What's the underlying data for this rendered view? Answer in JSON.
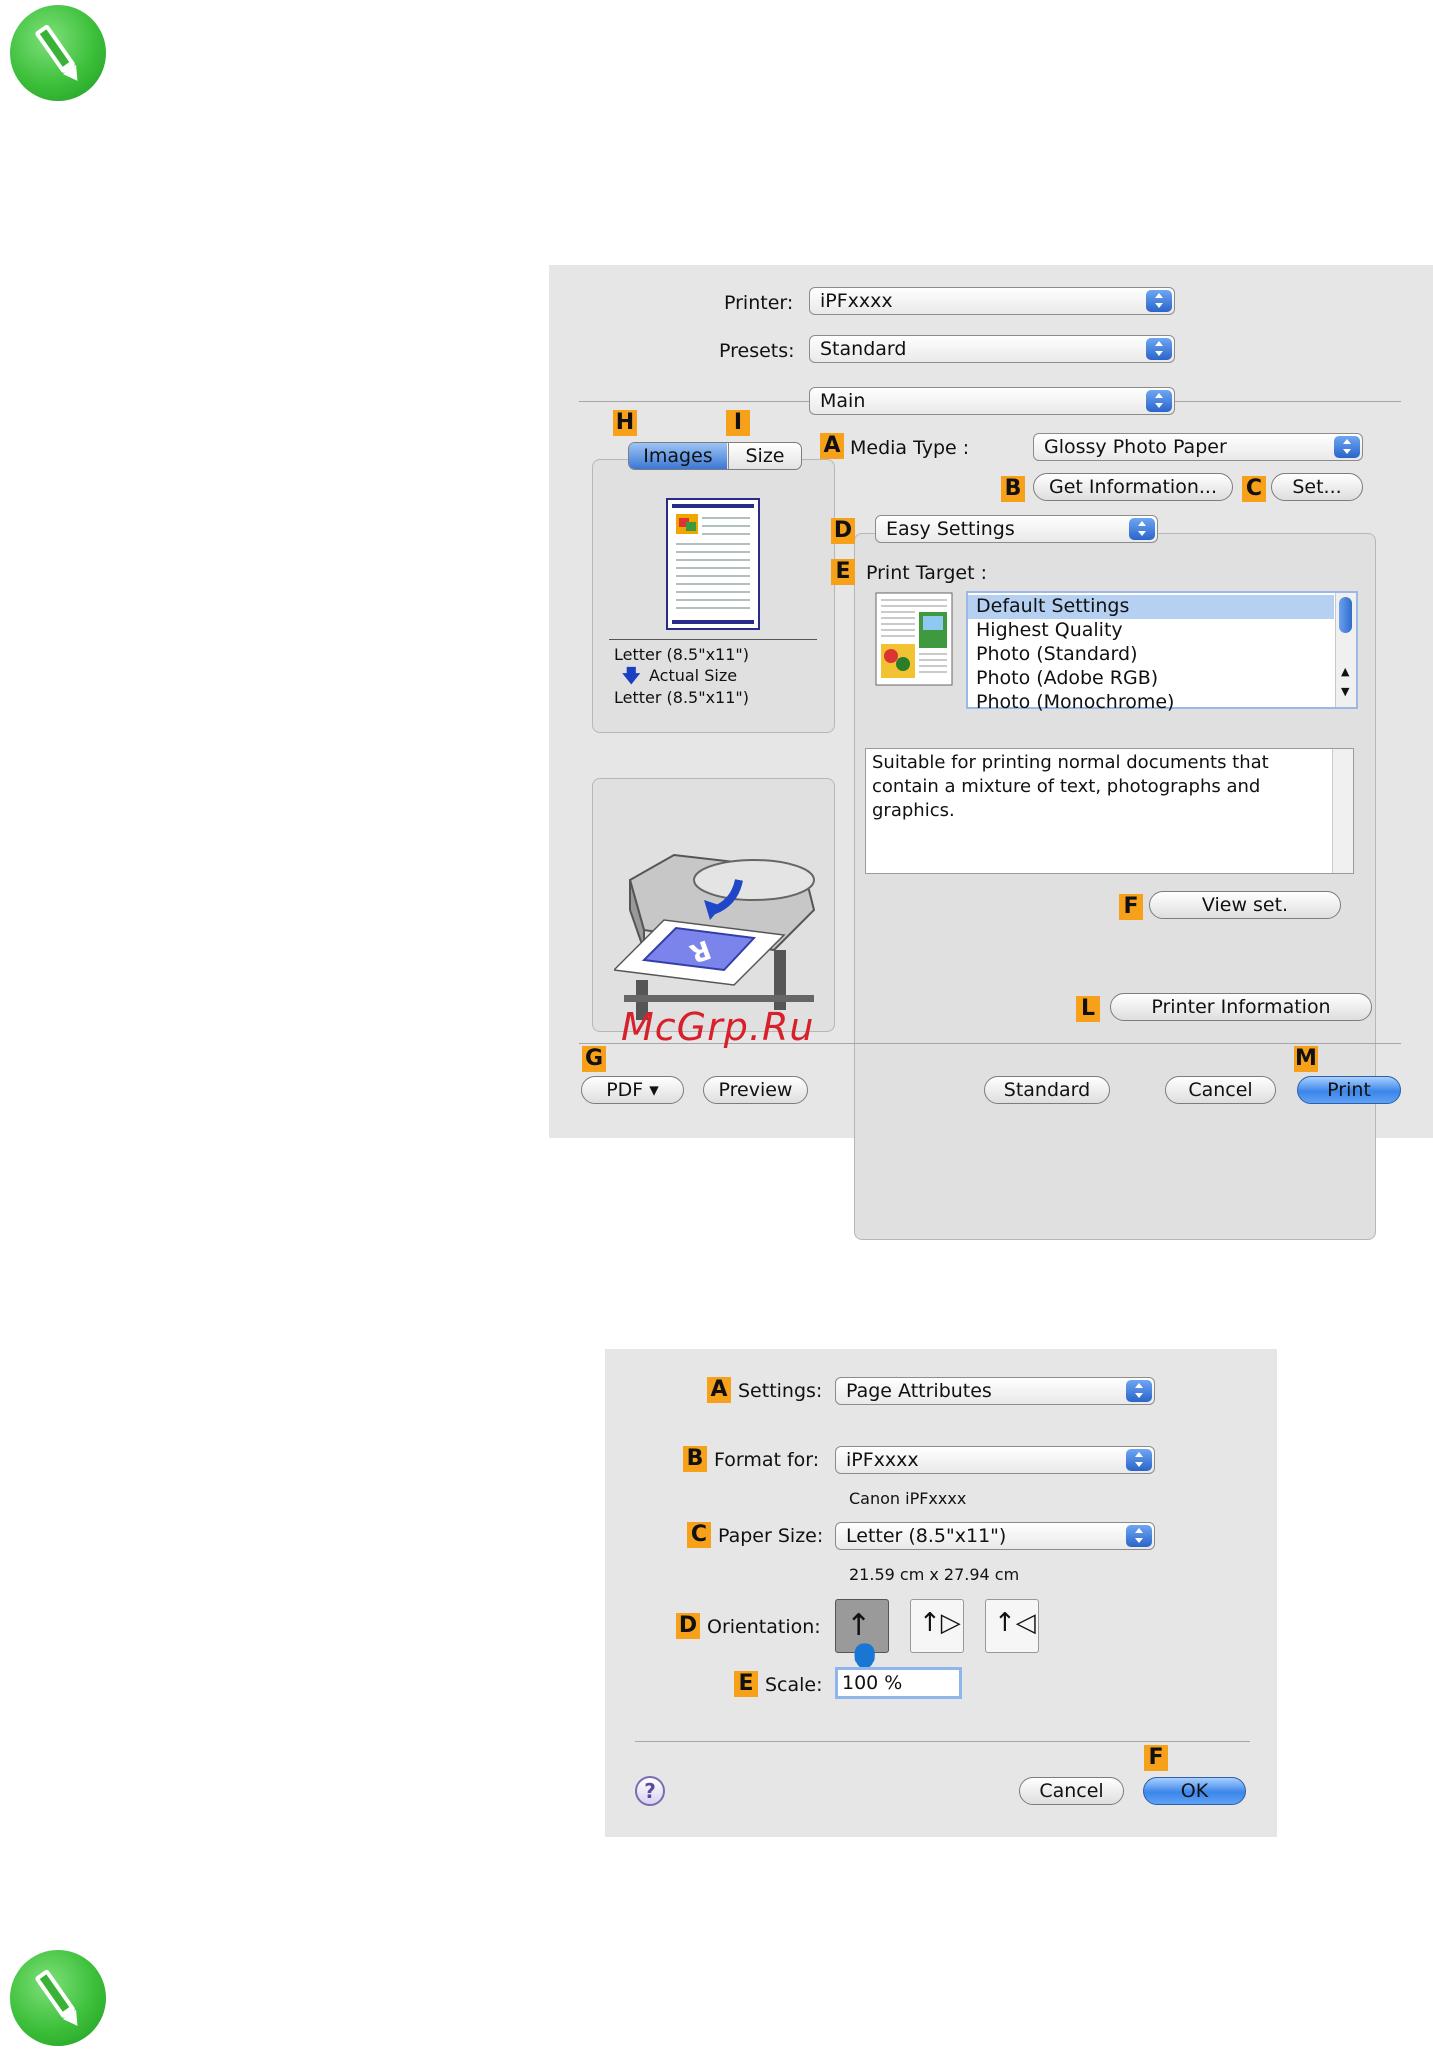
{
  "dialog1": {
    "printer_label": "Printer:",
    "printer_value": "iPFxxxx",
    "presets_label": "Presets:",
    "presets_value": "Standard",
    "pane_value": "Main",
    "tabs": {
      "images": "Images",
      "size": "Size"
    },
    "preview_text": {
      "line1": "Letter (8.5\"x11\")",
      "line2": "Actual Size",
      "line3": "Letter (8.5\"x11\")"
    },
    "media_type_label": "Media Type :",
    "media_type_value": "Glossy Photo Paper",
    "get_info_button": "Get Information...",
    "set_button": "Set...",
    "mode_value": "Easy Settings",
    "print_target_label": "Print Target :",
    "print_target_items": [
      "Default Settings",
      "Highest Quality",
      "Photo (Standard)",
      "Photo (Adobe RGB)",
      "Photo (Monochrome)"
    ],
    "description": "Suitable for printing normal documents that contain a mixture of text, photographs and graphics.",
    "view_set_button": "View set.",
    "printer_info_button": "Printer Information",
    "buttons": {
      "pdf": "PDF ▾",
      "preview": "Preview",
      "standard": "Standard",
      "cancel": "Cancel",
      "print": "Print"
    },
    "badges": {
      "a": "A",
      "b": "B",
      "c": "C",
      "d": "D",
      "e": "E",
      "f": "F",
      "g": "G",
      "h": "H",
      "i": "I",
      "l": "L",
      "m": "M"
    }
  },
  "watermark": "McGrp.Ru",
  "dialog2": {
    "settings_label": "Settings:",
    "settings_value": "Page Attributes",
    "format_label": "Format for:",
    "format_value": "iPFxxxx",
    "format_sub": "Canon iPFxxxx",
    "paper_label": "Paper Size:",
    "paper_value": "Letter (8.5\"x11\")",
    "paper_sub": "21.59 cm x 27.94 cm",
    "orientation_label": "Orientation:",
    "scale_label": "Scale:",
    "scale_value": "100 %",
    "help": "?",
    "cancel_button": "Cancel",
    "ok_button": "OK",
    "badges": {
      "a": "A",
      "b": "B",
      "c": "C",
      "d": "D",
      "e": "E",
      "f": "F"
    }
  }
}
